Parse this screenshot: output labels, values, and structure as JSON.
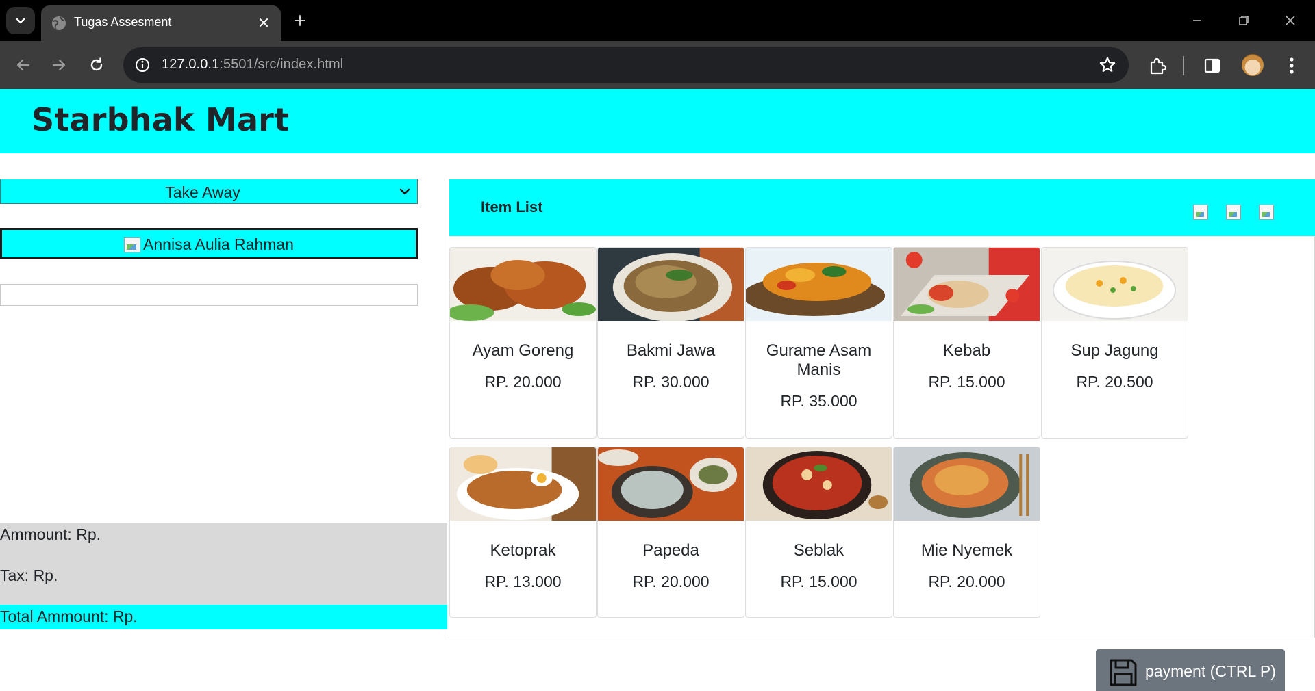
{
  "browser": {
    "tab_title": "Tugas Assesment",
    "url_host": "127.0.0.1",
    "url_rest": ":5501/src/index.html"
  },
  "page": {
    "brand": "Starbhak Mart",
    "order_type": {
      "selected": "Take Away"
    },
    "cashier_name": "Annisa Aulia Rahman",
    "summary": {
      "amount_label": "Ammount: Rp.",
      "tax_label": "Tax: Rp.",
      "total_label": "Total Ammount: Rp."
    },
    "item_list": {
      "title": "Item List",
      "items": [
        {
          "name": "Ayam Goreng",
          "price": "RP. 20.000"
        },
        {
          "name": "Bakmi Jawa",
          "price": "RP. 30.000"
        },
        {
          "name": "Gurame Asam Manis",
          "price": "RP. 35.000"
        },
        {
          "name": "Kebab",
          "price": "RP. 15.000"
        },
        {
          "name": "Sup Jagung",
          "price": "RP. 20.500"
        },
        {
          "name": "Ketoprak",
          "price": "RP. 13.000"
        },
        {
          "name": "Papeda",
          "price": "RP. 20.000"
        },
        {
          "name": "Seblak",
          "price": "RP. 15.000"
        },
        {
          "name": "Mie Nyemek",
          "price": "RP. 20.000"
        }
      ]
    },
    "payment_button": "payment (CTRL P)"
  },
  "colors": {
    "accent": "#00ffff",
    "summary_bg": "#d9d9d9",
    "button_gray": "#6c757d"
  }
}
